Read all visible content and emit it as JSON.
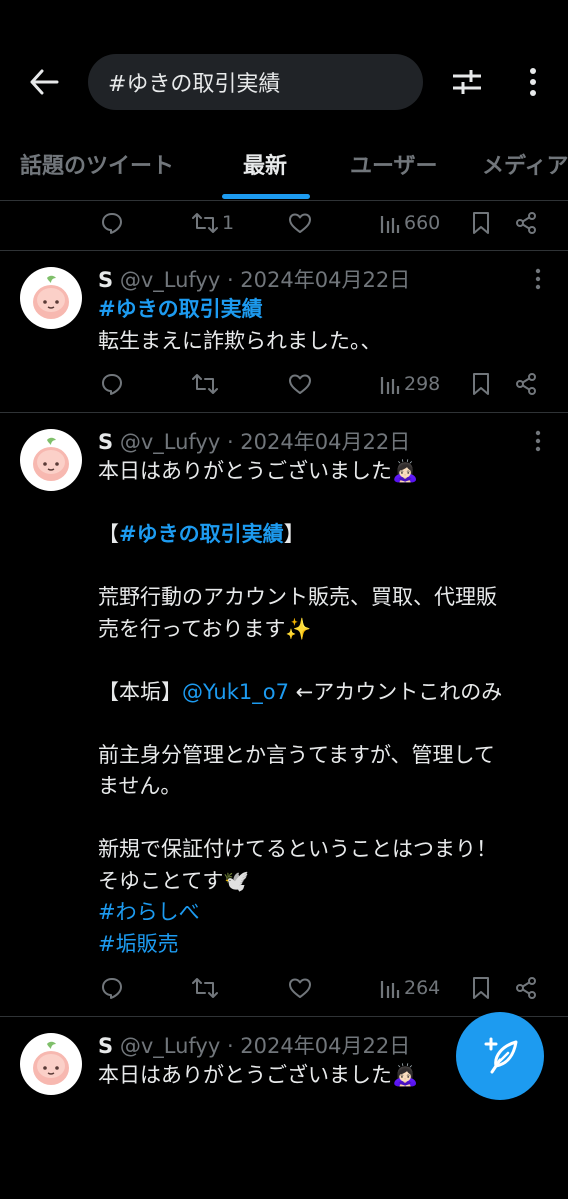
{
  "header": {
    "search_value": "#ゆきの取引実績"
  },
  "tabs": [
    {
      "label": "話題のツイート",
      "active": false
    },
    {
      "label": "最新",
      "active": true
    },
    {
      "label": "ユーザー",
      "active": false
    },
    {
      "label": "メディア",
      "active": false
    }
  ],
  "tweet0": {
    "retweets": "1",
    "views": "660"
  },
  "tweet1": {
    "name": "S",
    "handle": "@v_Lufyy",
    "date": "· 2024年04月22日",
    "hashtag": "#ゆきの取引実績",
    "text": "転生まえに詐欺られました。、",
    "views": "298"
  },
  "tweet2": {
    "name": "S",
    "handle": "@v_Lufyy",
    "date": "· 2024年04月22日",
    "line1": "本日はありがとうございました🙇🏻‍♀️",
    "bracket_open": "【",
    "hashtag_main": "#ゆきの取引実績",
    "bracket_close": "】",
    "line3a": "荒野行動のアカウント販売、買取、代理販",
    "line3b": "売を行っております✨",
    "honaka_label": "【本垢】",
    "mention": "@Yuk1_o7",
    "honaka_suffix": " ←アカウントこれのみ",
    "line5a": "前主身分管理とか言うてますが、管理して",
    "line5b": "ません。",
    "line6a": "新規で保証付けてるということはつまり！",
    "line6b": "そゆことてす🕊️",
    "tag2": "#わらしべ",
    "tag3": "#垢販売",
    "views": "264"
  },
  "tweet3": {
    "name": "S",
    "handle": "@v_Lufyy",
    "date": "· 2024年04月22日",
    "text": "本日はありがとうございました🙇🏻‍♀️"
  },
  "colors": {
    "accent": "#1d9bf0",
    "background": "#000000",
    "muted": "#71767b"
  }
}
